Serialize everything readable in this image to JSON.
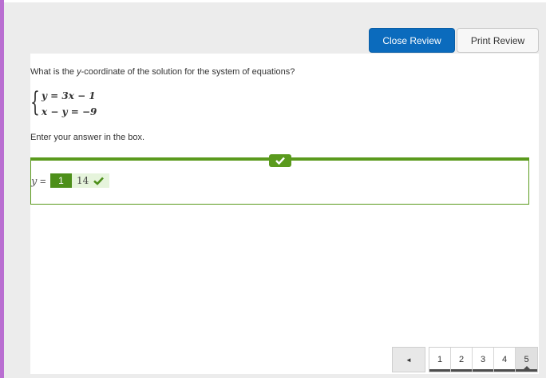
{
  "toolbar": {
    "close_review_label": "Close Review",
    "print_review_label": "Print Review"
  },
  "question": {
    "prompt_before": "What is the ",
    "prompt_var": "y",
    "prompt_after": "-coordinate of the solution for the system of equations?",
    "equations": [
      "y = 3x − 1",
      "x − y = −9"
    ],
    "instruction": "Enter your answer in the box."
  },
  "answer": {
    "label_var": "y",
    "label_suffix": " =",
    "response_number": "1",
    "response_value": "14",
    "status": "correct"
  },
  "pagination": {
    "prev_label": "◄",
    "pages": [
      "1",
      "2",
      "3",
      "4",
      "5"
    ],
    "current_page": "5"
  },
  "colors": {
    "accent_left": "#b96ed1",
    "primary_button": "#0b6bbd",
    "correct_green": "#5a9a1d",
    "correct_bg": "#e6f4dc"
  }
}
